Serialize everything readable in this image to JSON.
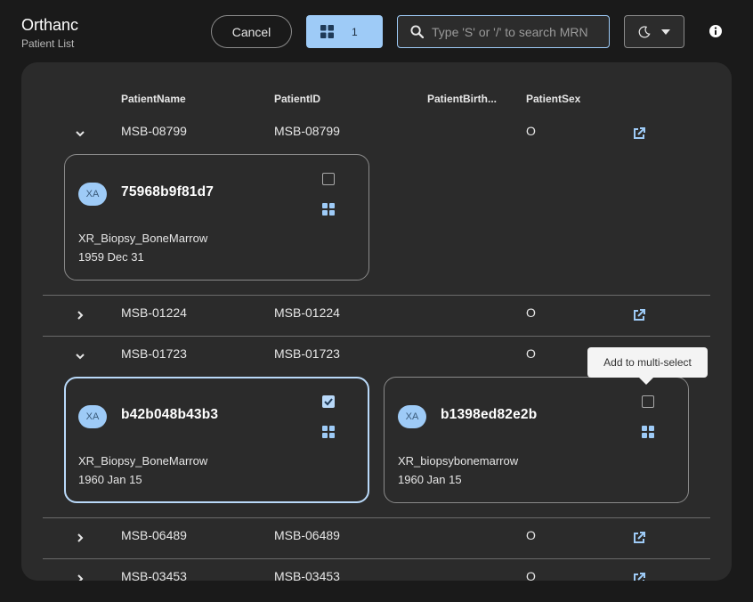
{
  "app": {
    "title": "Orthanc",
    "subtitle": "Patient List"
  },
  "toolbar": {
    "cancel_label": "Cancel",
    "multiselect_count": "1",
    "search_placeholder": "Type 'S' or '/' to search MRN",
    "theme_icon": "moon-icon",
    "info_icon": "info-icon"
  },
  "columns": [
    "PatientName",
    "PatientID",
    "PatientBirth...",
    "PatientSex"
  ],
  "patients": [
    {
      "name": "MSB-08799",
      "id": "MSB-08799",
      "birth": "",
      "sex": "O",
      "expanded": true,
      "studies": [
        {
          "modality": "XA",
          "uid": "75968b9f81d7",
          "description": "XR_Biopsy_BoneMarrow",
          "date": "1959 Dec 31",
          "checked": false
        }
      ]
    },
    {
      "name": "MSB-01224",
      "id": "MSB-01224",
      "birth": "",
      "sex": "O",
      "expanded": false
    },
    {
      "name": "MSB-01723",
      "id": "MSB-01723",
      "birth": "",
      "sex": "O",
      "expanded": true,
      "studies": [
        {
          "modality": "XA",
          "uid": "b42b048b43b3",
          "description": "XR_Biopsy_BoneMarrow",
          "date": "1960 Jan 15",
          "checked": true
        },
        {
          "modality": "XA",
          "uid": "b1398ed82e2b",
          "description": "XR_biopsybonemarrow",
          "date": "1960 Jan 15",
          "checked": false
        }
      ]
    },
    {
      "name": "MSB-06489",
      "id": "MSB-06489",
      "birth": "",
      "sex": "O",
      "expanded": false
    },
    {
      "name": "MSB-03453",
      "id": "MSB-03453",
      "birth": "",
      "sex": "O",
      "expanded": false
    }
  ],
  "tooltip": "Add to multi-select",
  "colors": {
    "accent": "#9ecbf7",
    "background": "#1a1a1a",
    "panel": "#2b2b2b"
  }
}
